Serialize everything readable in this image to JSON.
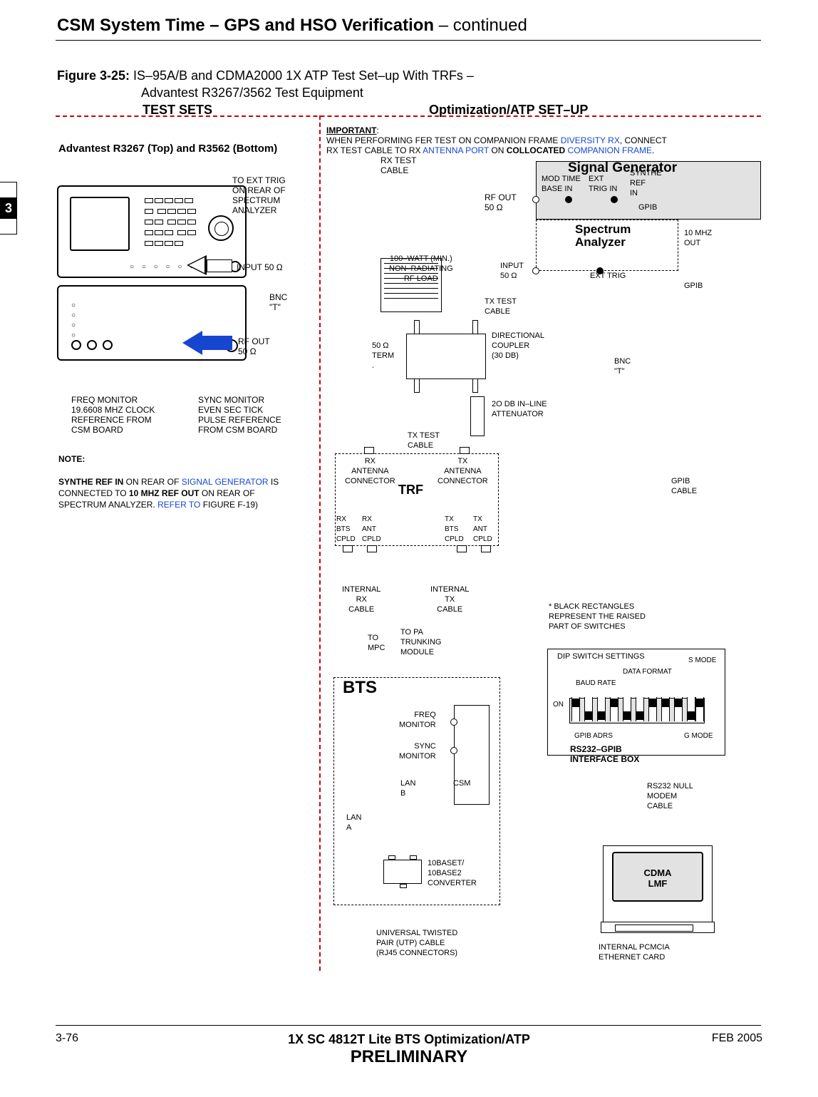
{
  "header": {
    "title": "CSM System Time – GPS and HSO Verification",
    "continued": " – continued"
  },
  "figure": {
    "number": "Figure 3-25:",
    "title": " IS–95A/B and CDMA2000 1X ATP Test Set–up With TRFs –",
    "subtitle": "Advantest R3267/3562 Test Equipment",
    "test_sets": "TEST SETS",
    "opt_setup": "Optimization/ATP SET–UP"
  },
  "advantest_label": "Advantest R3267 (Top) and R3562 (Bottom)",
  "side_tab": "3",
  "labels": {
    "to_ext_trig": "TO EXT TRIG\nON REAR OF\nSPECTRUM\nANALYZER",
    "input50": "INPUT 50 Ω",
    "bnc_t": "BNC\n\"T\"",
    "rf_out50": "RF OUT\n50 Ω",
    "freq_mon": "FREQ MONITOR\n19.6608 MHZ CLOCK\nREFERENCE FROM\nCSM BOARD",
    "sync_mon": "SYNC MONITOR\nEVEN SEC TICK\nPULSE REFERENCE\nFROM CSM BOARD",
    "important_hdr": "IMPORTANT",
    "important_body1": "WHEN PERFORMING FER TEST ON COMPANION FRAME ",
    "important_div": "DIVERSITY RX",
    "important_body2": ", CONNECT\nRX TEST CABLE TO RX ",
    "important_ant": "ANTENNA PORT",
    "important_body3": " ON ",
    "important_coll": "COLLOCATED",
    "important_comp": " COMPANION FRAME",
    "important_dot": ".",
    "rx_test_cable": "RX TEST\nCABLE",
    "rf_out_50": "RF OUT\n50 Ω",
    "signal_gen": "Signal Generator",
    "mod_time": "MOD TIME\nBASE IN",
    "ext_trig_in": "EXT\nTRIG IN",
    "synthe_ref": "SYNTHE\nREF\nIN",
    "gpib": "GPIB",
    "spectrum_analyzer": "Spectrum\nAnalyzer",
    "ten_mhz": "10 MHZ\nOUT",
    "input_50": "INPUT\n50 Ω",
    "ext_trig": "EXT TRIG",
    "bnc_t2": "BNC\n\"T\"",
    "hundred_watt": "100–WATT (MIN.)\nNON–RADIATING\nRF LOAD",
    "tx_test_cable": "TX TEST\nCABLE",
    "fifty_term": "50 Ω\nTERM\n.",
    "dir_coupler": "DIRECTIONAL\nCOUPLER\n(30 DB)",
    "twenty_db": "2O DB IN–LINE\nATTENUATOR",
    "tx_test_cable2": "TX TEST\nCABLE",
    "rx_ant_conn": "RX\nANTENNA\nCONNECTOR",
    "tx_ant_conn": "TX\nANTENNA\nCONNECTOR",
    "trf": "TRF",
    "rx_bts_cpld": "RX\nBTS\nCPLD",
    "rx_ant_cpld": "RX\nANT\nCPLD",
    "tx_bts_cpld": "TX\nBTS\nCPLD",
    "tx_ant_cpld": "TX\nANT\nCPLD",
    "internal_rx": "INTERNAL\nRX\nCABLE",
    "internal_tx": "INTERNAL\nTX\nCABLE",
    "to_mpc": "TO\nMPC",
    "to_pa": "TO PA\nTRUNKING\nMODULE",
    "bts": "BTS",
    "freq_monitor": "FREQ\nMONITOR",
    "sync_monitor": "SYNC\nMONITOR",
    "lan_b": "LAN\nB",
    "lan_a": "LAN\nA",
    "csm": "CSM",
    "tenbase": "10BASET/\n10BASE2\nCONVERTER",
    "utp": "UNIVERSAL TWISTED\nPAIR (UTP) CABLE\n(RJ45 CONNECTORS)",
    "gpib_cable": "GPIB\nCABLE",
    "black_rect": "* BLACK RECTANGLES\nREPRESENT THE RAISED\nPART OF SWITCHES",
    "dip_settings": "DIP SWITCH SETTINGS",
    "s_mode": "S MODE",
    "data_format": "DATA FORMAT",
    "baud_rate": "BAUD RATE",
    "on": "ON",
    "gpib_adrs": "GPIB ADRS",
    "g_mode": "G MODE",
    "rs232_gpib": "RS232–GPIB\nINTERFACE BOX",
    "rs232_null": "RS232 NULL\nMODEM\nCABLE",
    "cdma_lmf": "CDMA\nLMF",
    "pcmcia": "INTERNAL PCMCIA\nETHERNET CARD"
  },
  "note": {
    "header": "NOTE:",
    "body1": "SYNTHE REF IN",
    "body2": " ON REAR OF ",
    "body3": "SIGNAL GENERATOR",
    "body4": " IS\nCONNECTED TO ",
    "body5": "10 MHZ REF OUT",
    "body6": " ON REAR OF\nSPECTRUM ANALYZER. ",
    "body7": "REFER TO",
    "body8": " FIGURE F-19)"
  },
  "footer": {
    "left": "3-76",
    "center1": "1X SC 4812T Lite BTS Optimization/ATP",
    "center2": "PRELIMINARY",
    "right": "FEB 2005"
  }
}
